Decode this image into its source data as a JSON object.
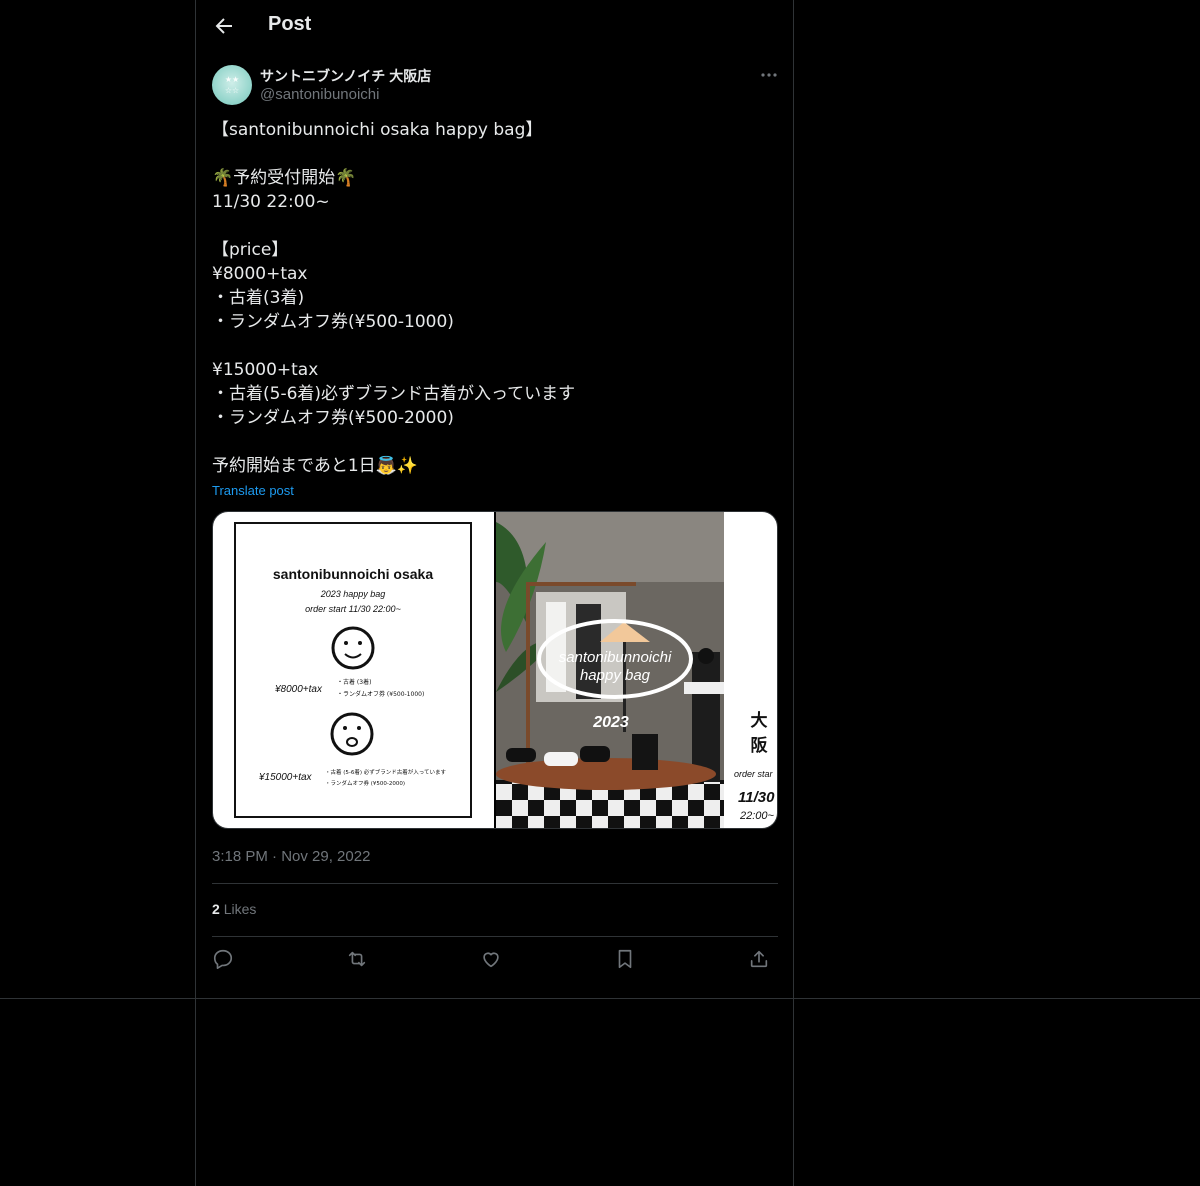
{
  "header": {
    "title": "Post"
  },
  "author": {
    "display_name": "サントニブンノイチ 大阪店",
    "handle": "@santonibunoichi"
  },
  "post": {
    "text": "【santonibunnoichi osaka happy bag】\n\n🌴予約受付開始🌴\n11/30 22:00~\n\n【price】\n¥8000+tax\n・古着(3着)\n・ランダムオフ券(¥500-1000)\n\n¥15000+tax\n・古着(5-6着)必ずブランド古着が入っています\n・ランダムオフ券(¥500-2000)\n\n予約開始まであと1日👼✨",
    "translate_label": "Translate post",
    "timestamp": "3:18 PM · Nov 29, 2022"
  },
  "stats": {
    "likes_count": "2",
    "likes_label": "Likes"
  },
  "media": {
    "flyer": {
      "title": "santonibunnoichi osaka",
      "subtitle": "2023 happy bag",
      "order_start": "order start 11/30 22:00~",
      "price1": "¥8000+tax",
      "price1_items": [
        "・古着 (3着)",
        "・ランダムオフ券 (¥500-1000)"
      ],
      "price2": "¥15000+tax",
      "price2_items": [
        "・古着 (5-6着) 必ずブランド古着が入っています",
        "・ランダムオフ券 (¥500-2000)"
      ]
    },
    "photo": {
      "logo_line1": "santonibunnoichi",
      "logo_line2": "happy bag",
      "year": "2023",
      "side_kanji1": "大",
      "side_kanji2": "阪",
      "side_order": "order star",
      "side_date": "11/30",
      "side_time": "22:00~"
    }
  },
  "colors": {
    "background": "#000000",
    "text": "#e7e9ea",
    "muted": "#71767b",
    "link": "#1d9bf0",
    "border": "#2f3336"
  },
  "icons": [
    "back-arrow-icon",
    "more-icon",
    "reply-icon",
    "repost-icon",
    "like-icon",
    "bookmark-icon",
    "share-icon"
  ]
}
